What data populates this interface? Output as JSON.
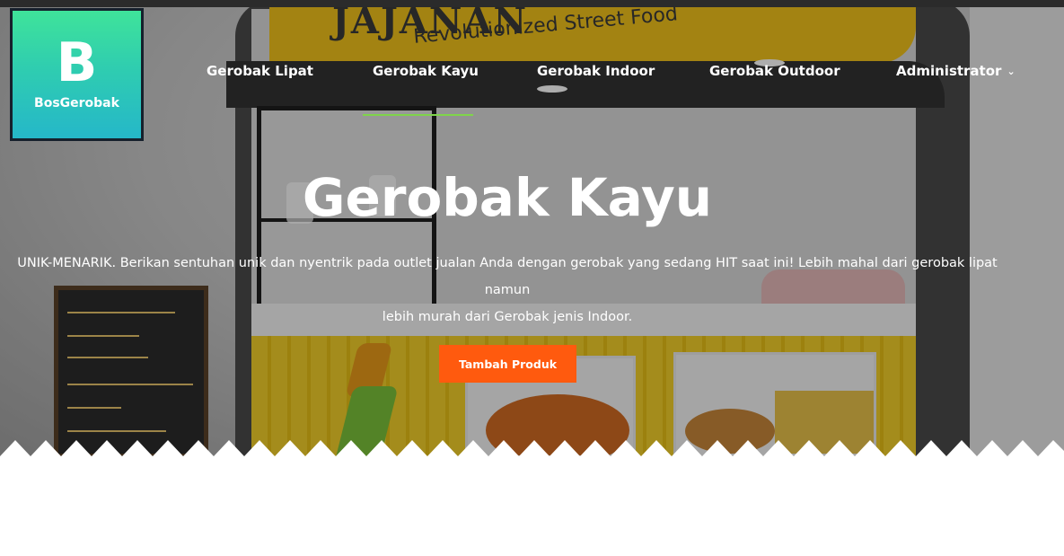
{
  "brand": {
    "mark": "B",
    "name": "BosGerobak"
  },
  "nav": {
    "items": [
      {
        "label": "Gerobak Lipat"
      },
      {
        "label": "Gerobak Kayu"
      },
      {
        "label": "Gerobak Indoor"
      },
      {
        "label": "Gerobak Outdoor"
      },
      {
        "label": "Administrator"
      }
    ],
    "active_index": 1,
    "active_underline_color": "#7fd44a"
  },
  "hero": {
    "title": "Gerobak Kayu",
    "description_line1": "UNIK-MENARIK. Berikan sentuhan unik dan nyentrik pada outlet jualan Anda dengan gerobak yang sedang HIT saat ini! Lebih mahal dari gerobak lipat namun",
    "description_line2": "lebih murah dari Gerobak jenis Indoor.",
    "cta_label": "Tambah Produk",
    "cta_color": "#ff5a0e",
    "background_sign": "JAJANAN",
    "background_sign_sub": "Revolutionized Street Food"
  },
  "icons": {
    "dropdown": "chevron-down-icon"
  }
}
